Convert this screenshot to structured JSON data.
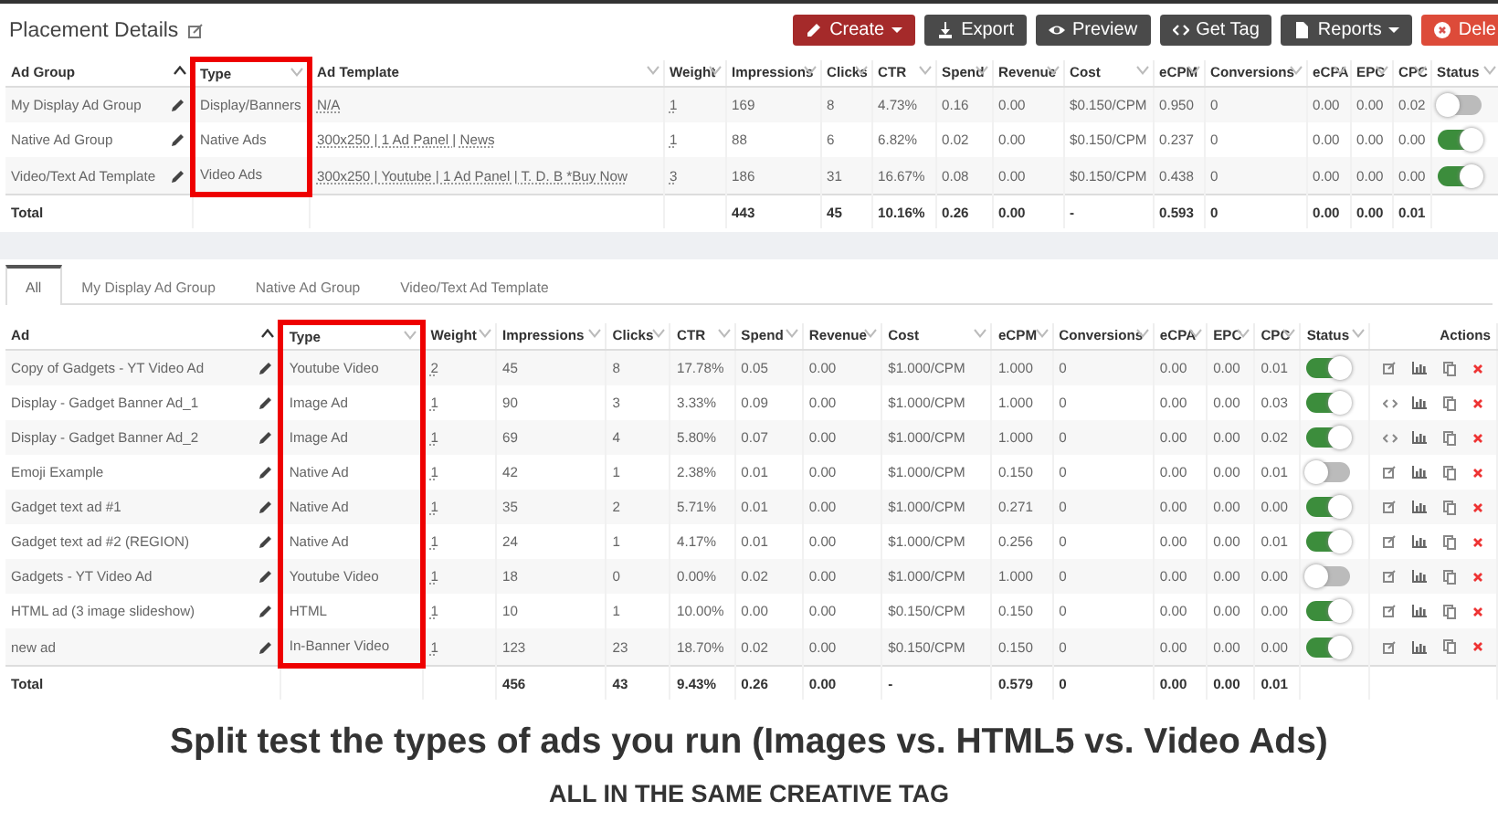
{
  "header": {
    "title": "Placement Details",
    "buttons": [
      {
        "kind": "create",
        "label": "Create",
        "dropdown": true
      },
      {
        "kind": "export",
        "label": "Export",
        "dropdown": false
      },
      {
        "kind": "preview",
        "label": "Preview",
        "dropdown": false
      },
      {
        "kind": "tag",
        "label": "Get Tag",
        "dropdown": false
      },
      {
        "kind": "reports",
        "label": "Reports",
        "dropdown": true
      },
      {
        "kind": "delete",
        "label": "Dele",
        "dropdown": false
      }
    ]
  },
  "top_table": {
    "columns": [
      {
        "label": "Ad Group",
        "kind": "name",
        "sorted": true,
        "highlight": false
      },
      {
        "label": "Type",
        "kind": "text",
        "sorted": false,
        "highlight": true
      },
      {
        "label": "Ad Template",
        "kind": "link",
        "sorted": false,
        "highlight": false
      },
      {
        "label": "Weight",
        "kind": "link",
        "sorted": false,
        "highlight": false
      },
      {
        "label": "Impressions",
        "kind": "text",
        "sorted": false,
        "highlight": false
      },
      {
        "label": "Clicks",
        "kind": "text",
        "sorted": false,
        "highlight": false
      },
      {
        "label": "CTR",
        "kind": "text",
        "sorted": false,
        "highlight": false
      },
      {
        "label": "Spend",
        "kind": "text",
        "sorted": false,
        "highlight": false
      },
      {
        "label": "Revenue",
        "kind": "text",
        "sorted": false,
        "highlight": false
      },
      {
        "label": "Cost",
        "kind": "text",
        "sorted": false,
        "highlight": false
      },
      {
        "label": "eCPM",
        "kind": "text",
        "sorted": false,
        "highlight": false
      },
      {
        "label": "Conversions",
        "kind": "text",
        "sorted": false,
        "highlight": false
      },
      {
        "label": "eCPA",
        "kind": "text",
        "sorted": false,
        "highlight": false
      },
      {
        "label": "EPC",
        "kind": "text",
        "sorted": false,
        "highlight": false
      },
      {
        "label": "CPC",
        "kind": "text",
        "sorted": false,
        "highlight": false
      },
      {
        "label": "Status",
        "kind": "status",
        "sorted": false,
        "highlight": false
      }
    ],
    "rows": [
      {
        "cells": [
          "My Display Ad Group",
          "Display/Banners",
          "N/A",
          "1",
          "169",
          "8",
          "4.73%",
          "0.16",
          "0.00",
          "$0.150/CPM",
          "0.950",
          "0",
          "0.00",
          "0.00",
          "0.02"
        ],
        "active": false
      },
      {
        "cells": [
          "Native Ad Group",
          "Native Ads",
          "300x250 | 1 Ad Panel | News",
          "1",
          "88",
          "6",
          "6.82%",
          "0.02",
          "0.00",
          "$0.150/CPM",
          "0.237",
          "0",
          "0.00",
          "0.00",
          "0.00"
        ],
        "active": true
      },
      {
        "cells": [
          "Video/Text Ad Template",
          "Video Ads",
          "300x250 | Youtube | 1 Ad Panel | T. D. B *Buy Now",
          "3",
          "186",
          "31",
          "16.67%",
          "0.08",
          "0.00",
          "$0.150/CPM",
          "0.438",
          "0",
          "0.00",
          "0.00",
          "0.00"
        ],
        "active": true
      }
    ],
    "total": {
      "label": "Total",
      "cells": [
        "443",
        "45",
        "10.16%",
        "0.26",
        "0.00",
        "-",
        "0.593",
        "0",
        "0.00",
        "0.00",
        "0.01"
      ]
    }
  },
  "tabs": [
    {
      "label": "All",
      "selected": true
    },
    {
      "label": "My Display Ad Group",
      "selected": false
    },
    {
      "label": "Native Ad Group",
      "selected": false
    },
    {
      "label": "Video/Text Ad Template",
      "selected": false
    }
  ],
  "bottom_table": {
    "columns": [
      {
        "label": "Ad",
        "kind": "name",
        "sorted": true,
        "highlight": false
      },
      {
        "label": "Type",
        "kind": "text",
        "sorted": false,
        "highlight": true
      },
      {
        "label": "Weight",
        "kind": "link",
        "sorted": false,
        "highlight": false
      },
      {
        "label": "Impressions",
        "kind": "text",
        "sorted": false,
        "highlight": false
      },
      {
        "label": "Clicks",
        "kind": "text",
        "sorted": false,
        "highlight": false
      },
      {
        "label": "CTR",
        "kind": "text",
        "sorted": false,
        "highlight": false
      },
      {
        "label": "Spend",
        "kind": "text",
        "sorted": false,
        "highlight": false
      },
      {
        "label": "Revenue",
        "kind": "text",
        "sorted": false,
        "highlight": false
      },
      {
        "label": "Cost",
        "kind": "text",
        "sorted": false,
        "highlight": false
      },
      {
        "label": "eCPM",
        "kind": "text",
        "sorted": false,
        "highlight": false
      },
      {
        "label": "Conversions",
        "kind": "text",
        "sorted": false,
        "highlight": false
      },
      {
        "label": "eCPA",
        "kind": "text",
        "sorted": false,
        "highlight": false
      },
      {
        "label": "EPC",
        "kind": "text",
        "sorted": false,
        "highlight": false
      },
      {
        "label": "CPC",
        "kind": "text",
        "sorted": false,
        "highlight": false
      },
      {
        "label": "Status",
        "kind": "status",
        "sorted": false,
        "highlight": false
      },
      {
        "label": "Actions",
        "kind": "actions",
        "highlight": false
      }
    ],
    "rows": [
      {
        "cells": [
          "Copy of Gadgets - YT Video Ad",
          "Youtube Video",
          "2",
          "45",
          "8",
          "17.78%",
          "0.05",
          "0.00",
          "$1.000/CPM",
          "1.000",
          "0",
          "0.00",
          "0.00",
          "0.01"
        ],
        "active": true,
        "kind": "edit"
      },
      {
        "cells": [
          "Display - Gadget Banner Ad_1",
          "Image Ad",
          "1",
          "90",
          "3",
          "3.33%",
          "0.09",
          "0.00",
          "$1.000/CPM",
          "1.000",
          "0",
          "0.00",
          "0.00",
          "0.03"
        ],
        "active": true,
        "kind": "code"
      },
      {
        "cells": [
          "Display - Gadget Banner Ad_2",
          "Image Ad",
          "1",
          "69",
          "4",
          "5.80%",
          "0.07",
          "0.00",
          "$1.000/CPM",
          "1.000",
          "0",
          "0.00",
          "0.00",
          "0.02"
        ],
        "active": true,
        "kind": "code"
      },
      {
        "cells": [
          "Emoji Example",
          "Native Ad",
          "1",
          "42",
          "1",
          "2.38%",
          "0.01",
          "0.00",
          "$1.000/CPM",
          "0.150",
          "0",
          "0.00",
          "0.00",
          "0.01"
        ],
        "active": false,
        "kind": "edit"
      },
      {
        "cells": [
          "Gadget text ad #1",
          "Native Ad",
          "1",
          "35",
          "2",
          "5.71%",
          "0.01",
          "0.00",
          "$1.000/CPM",
          "0.271",
          "0",
          "0.00",
          "0.00",
          "0.00"
        ],
        "active": true,
        "kind": "edit"
      },
      {
        "cells": [
          "Gadget text ad #2 (REGION)",
          "Native Ad",
          "1",
          "24",
          "1",
          "4.17%",
          "0.01",
          "0.00",
          "$1.000/CPM",
          "0.256",
          "0",
          "0.00",
          "0.00",
          "0.01"
        ],
        "active": true,
        "kind": "edit"
      },
      {
        "cells": [
          "Gadgets - YT Video Ad",
          "Youtube Video",
          "1",
          "18",
          "0",
          "0.00%",
          "0.02",
          "0.00",
          "$1.000/CPM",
          "1.000",
          "0",
          "0.00",
          "0.00",
          "0.00"
        ],
        "active": false,
        "kind": "edit"
      },
      {
        "cells": [
          "HTML ad (3 image slideshow)",
          "HTML",
          "1",
          "10",
          "1",
          "10.00%",
          "0.00",
          "0.00",
          "$0.150/CPM",
          "0.150",
          "0",
          "0.00",
          "0.00",
          "0.00"
        ],
        "active": true,
        "kind": "edit"
      },
      {
        "cells": [
          "new ad",
          "In-Banner Video",
          "1",
          "123",
          "23",
          "18.70%",
          "0.02",
          "0.00",
          "$0.150/CPM",
          "0.150",
          "0",
          "0.00",
          "0.00",
          "0.00"
        ],
        "active": true,
        "kind": "edit"
      }
    ],
    "total": {
      "label": "Total",
      "cells": [
        "456",
        "43",
        "9.43%",
        "0.26",
        "0.00",
        "-",
        "0.579",
        "0",
        "0.00",
        "0.00",
        "0.01"
      ]
    }
  },
  "caption": {
    "headline": "Split test the types of ads you run (Images vs. HTML5 vs. Video Ads)",
    "subline": "ALL IN THE SAME CREATIVE TAG"
  }
}
